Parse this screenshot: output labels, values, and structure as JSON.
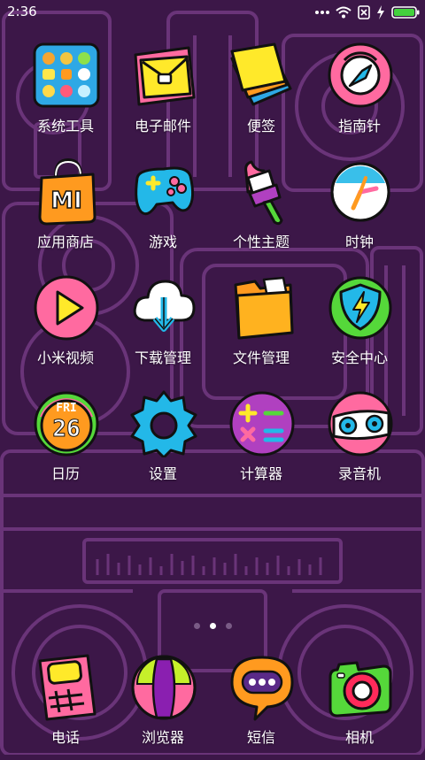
{
  "status_bar": {
    "time": "2:36",
    "icons": [
      "dots-icon",
      "wifi-icon",
      "no-sim-icon",
      "charging-icon",
      "battery-icon"
    ],
    "battery_color": "#43d13d"
  },
  "apps": [
    {
      "label": "系统工具",
      "icon": "folder-icon"
    },
    {
      "label": "电子邮件",
      "icon": "mail-icon"
    },
    {
      "label": "便签",
      "icon": "notes-icon"
    },
    {
      "label": "指南针",
      "icon": "compass-icon"
    },
    {
      "label": "应用商店",
      "icon": "app-store-icon",
      "icon_text": "MI"
    },
    {
      "label": "游戏",
      "icon": "gamepad-icon"
    },
    {
      "label": "个性主题",
      "icon": "paint-brush-icon"
    },
    {
      "label": "时钟",
      "icon": "clock-icon"
    },
    {
      "label": "小米视频",
      "icon": "play-icon"
    },
    {
      "label": "下载管理",
      "icon": "download-cloud-icon"
    },
    {
      "label": "文件管理",
      "icon": "file-folder-icon"
    },
    {
      "label": "安全中心",
      "icon": "shield-icon"
    },
    {
      "label": "日历",
      "icon": "calendar-icon",
      "icon_text": "FRI",
      "icon_number": "26"
    },
    {
      "label": "设置",
      "icon": "gear-icon"
    },
    {
      "label": "计算器",
      "icon": "calculator-icon"
    },
    {
      "label": "录音机",
      "icon": "recorder-icon"
    }
  ],
  "dock": [
    {
      "label": "电话",
      "icon": "phone-icon"
    },
    {
      "label": "浏览器",
      "icon": "browser-icon"
    },
    {
      "label": "短信",
      "icon": "message-icon"
    },
    {
      "label": "相机",
      "icon": "camera-icon"
    }
  ],
  "page_indicator": {
    "pages": 3,
    "current": 2
  },
  "colors": {
    "background": "#3c1748",
    "line_art": "#6f3b7f",
    "yellow": "#ffe92a",
    "pink": "#ff6aa0",
    "cyan": "#23b8e8",
    "orange": "#ff9a1f",
    "green": "#55d83a"
  }
}
